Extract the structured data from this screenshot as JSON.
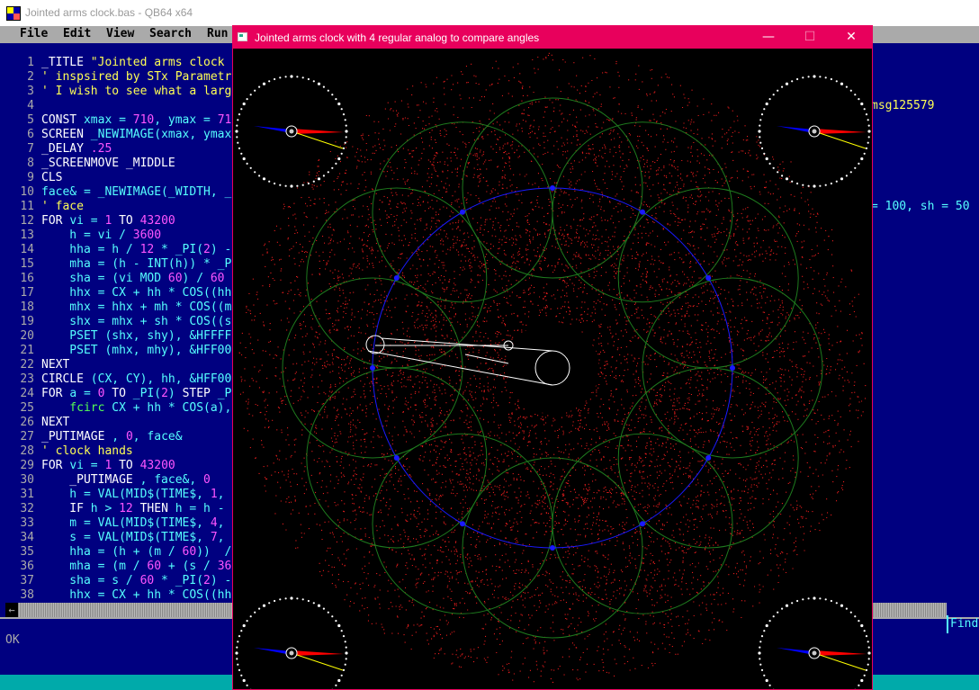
{
  "ide": {
    "title": "Jointed arms clock.bas - QB64 x64",
    "menu": [
      "File",
      "Edit",
      "View",
      "Search",
      "Run"
    ],
    "line_numbers": [
      "1",
      "2",
      "3",
      "4",
      "5",
      "6",
      "7",
      "8",
      "9",
      "10",
      "11",
      "12",
      "13",
      "14",
      "15",
      "16",
      "17",
      "18",
      "19",
      "20",
      "21",
      "22",
      "23",
      "24",
      "25",
      "26",
      "27",
      "28",
      "29",
      "30",
      "31",
      "32",
      "33",
      "34",
      "35",
      "36",
      "37",
      "38"
    ],
    "code": [
      [
        [
          "kw",
          "_TITLE "
        ],
        [
          "str",
          "\"Jointed arms clock"
        ]
      ],
      [
        [
          "cmt",
          "' inspsired by STx Parametr"
        ]
      ],
      [
        [
          "cmt",
          "' I wish to see what a larg"
        ]
      ],
      [
        [
          "kw",
          ""
        ]
      ],
      [
        [
          "kw",
          "CONST "
        ],
        [
          "",
          "xmax = "
        ],
        [
          "num",
          "710"
        ],
        [
          "",
          ", ymax = "
        ],
        [
          "num",
          "71"
        ]
      ],
      [
        [
          "kw",
          "SCREEN "
        ],
        [
          "",
          "_NEWIMAGE(xmax, ymax"
        ]
      ],
      [
        [
          "kw",
          "_DELAY "
        ],
        [
          "num",
          ".25"
        ]
      ],
      [
        [
          "kw",
          "_SCREENMOVE _MIDDLE"
        ]
      ],
      [
        [
          "kw",
          "CLS"
        ]
      ],
      [
        [
          "",
          "face& = _NEWIMAGE(_WIDTH, _"
        ]
      ],
      [
        [
          "cmt",
          "' face"
        ]
      ],
      [
        [
          "kw",
          "FOR "
        ],
        [
          "",
          "vi = "
        ],
        [
          "num",
          "1"
        ],
        [
          "kw",
          " TO "
        ],
        [
          "num",
          "43200"
        ]
      ],
      [
        [
          "",
          "    h = vi / "
        ],
        [
          "num",
          "3600"
        ]
      ],
      [
        [
          "",
          "    hha = h / "
        ],
        [
          "num",
          "12"
        ],
        [
          "",
          " * _PI("
        ],
        [
          "num",
          "2"
        ],
        [
          "",
          ") -"
        ]
      ],
      [
        [
          "",
          "    mha = (h - INT(h)) * _P"
        ]
      ],
      [
        [
          "",
          "    sha = (vi MOD "
        ],
        [
          "num",
          "60"
        ],
        [
          "",
          ") / "
        ],
        [
          "num",
          "60"
        ]
      ],
      [
        [
          "",
          "    hhx = CX + hh * COS((hh"
        ]
      ],
      [
        [
          "",
          "    mhx = hhx + mh * COS((m"
        ]
      ],
      [
        [
          "",
          "    shx = mhx + sh * COS((s"
        ]
      ],
      [
        [
          "",
          "    PSET (shx, shy), &HFFFF"
        ]
      ],
      [
        [
          "",
          "    PSET (mhx, mhy), &HFF00"
        ]
      ],
      [
        [
          "kw",
          "NEXT"
        ]
      ],
      [
        [
          "kw",
          "CIRCLE "
        ],
        [
          "",
          "(CX, CY), hh, &HFF00"
        ]
      ],
      [
        [
          "kw",
          "FOR "
        ],
        [
          "",
          "a = "
        ],
        [
          "num",
          "0"
        ],
        [
          "kw",
          " TO "
        ],
        [
          "",
          "_PI("
        ],
        [
          "num",
          "2"
        ],
        [
          "",
          ") "
        ],
        [
          "kw",
          "STEP "
        ],
        [
          "",
          "_P"
        ]
      ],
      [
        [
          "fn",
          "    fcirc "
        ],
        [
          "",
          "CX + hh * COS(a),"
        ]
      ],
      [
        [
          "kw",
          "NEXT"
        ]
      ],
      [
        [
          "kw",
          "_PUTIMAGE "
        ],
        [
          "",
          ", "
        ],
        [
          "num",
          "0"
        ],
        [
          "",
          ", face&"
        ]
      ],
      [
        [
          "cmt",
          "' clock hands"
        ]
      ],
      [
        [
          "kw",
          "FOR "
        ],
        [
          "",
          "vi = "
        ],
        [
          "num",
          "1"
        ],
        [
          "kw",
          " TO "
        ],
        [
          "num",
          "43200"
        ]
      ],
      [
        [
          "kw",
          "    _PUTIMAGE "
        ],
        [
          "",
          ", face&, "
        ],
        [
          "num",
          "0"
        ]
      ],
      [
        [
          "",
          "    h = VAL(MID$(TIME$, "
        ],
        [
          "num",
          "1"
        ],
        [
          "",
          ","
        ]
      ],
      [
        [
          "kw",
          "    IF "
        ],
        [
          "",
          "h > "
        ],
        [
          "num",
          "12"
        ],
        [
          "kw",
          " THEN "
        ],
        [
          "",
          "h = h -"
        ]
      ],
      [
        [
          "",
          "    m = VAL(MID$(TIME$, "
        ],
        [
          "num",
          "4"
        ],
        [
          "",
          ","
        ]
      ],
      [
        [
          "",
          "    s = VAL(MID$(TIME$, "
        ],
        [
          "num",
          "7"
        ],
        [
          "",
          ","
        ]
      ],
      [
        [
          "",
          "    hha = (h + (m / "
        ],
        [
          "num",
          "60"
        ],
        [
          "",
          "))  /"
        ]
      ],
      [
        [
          "",
          "    mha = (m / "
        ],
        [
          "num",
          "60"
        ],
        [
          "",
          " + (s / "
        ],
        [
          "num",
          "36"
        ]
      ],
      [
        [
          "",
          "    sha = s / "
        ],
        [
          "num",
          "60"
        ],
        [
          "",
          " * _PI("
        ],
        [
          "num",
          "2"
        ],
        [
          "",
          ") -"
        ]
      ],
      [
        [
          "",
          "    hhx = CX + hh * COS((hh"
        ]
      ]
    ],
    "right_fragment_1": "msg125579",
    "right_fragment_2": "= 100, sh = 50",
    "status_text": "OK",
    "find_label": "Find"
  },
  "program_window": {
    "title": "Jointed arms clock with 4 regular analog to compare angles",
    "minimize_icon": "minimize-icon",
    "maximize_icon": "maximize-icon",
    "close_icon": "close-icon"
  },
  "colors": {
    "ide_bg": "#000080",
    "program_border": "#e8005c",
    "dots_red": "#ff2020",
    "circles_green": "#1e7a1e",
    "circle_blue": "#1a1aff",
    "hand_blue": "#0000ff",
    "hand_red": "#ff0000",
    "hand_yellow": "#ffff00"
  }
}
